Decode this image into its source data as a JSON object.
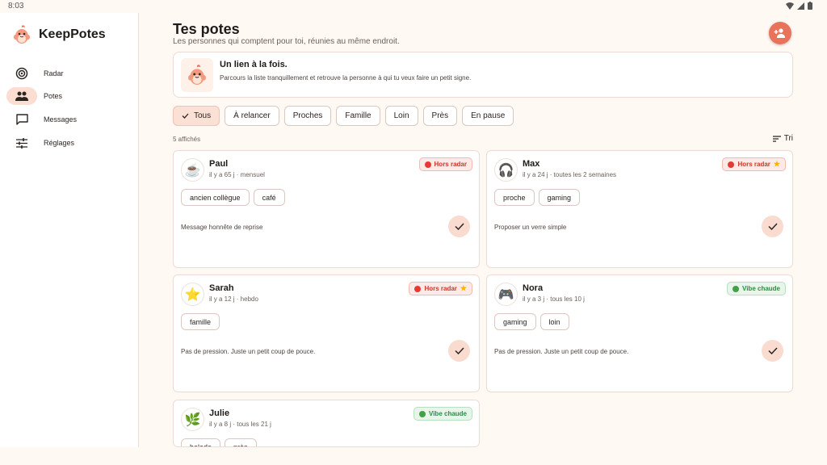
{
  "status": {
    "time": "8:03"
  },
  "app": {
    "name": "KeepPotes"
  },
  "nav": [
    {
      "label": "Radar",
      "icon": "radar-icon"
    },
    {
      "label": "Potes",
      "icon": "people-icon",
      "active": true
    },
    {
      "label": "Messages",
      "icon": "message-icon"
    },
    {
      "label": "Réglages",
      "icon": "settings-sliders-icon"
    }
  ],
  "header": {
    "title": "Tes potes",
    "subtitle": "Les personnes qui comptent pour toi, réunies au même endroit."
  },
  "hero": {
    "title": "Un lien à la fois.",
    "text": "Parcours la liste tranquillement et retrouve la personne à qui tu veux faire un petit signe."
  },
  "filters": [
    {
      "label": "Tous",
      "selected": true
    },
    {
      "label": "À relancer"
    },
    {
      "label": "Proches"
    },
    {
      "label": "Famille"
    },
    {
      "label": "Loin"
    },
    {
      "label": "Près"
    },
    {
      "label": "En pause"
    }
  ],
  "list": {
    "count_label": "5 affichés",
    "sort_label": "Tri"
  },
  "friends": [
    {
      "name": "Paul",
      "avatar": "☕",
      "meta": "il y a 65 j · mensuel",
      "badge": "Hors radar",
      "badge_type": "red",
      "starred": false,
      "tags": [
        "ancien collègue",
        "café"
      ],
      "note": "Message honnête de reprise"
    },
    {
      "name": "Max",
      "avatar": "🎧",
      "meta": "il y a 24 j · toutes les 2 semaines",
      "badge": "Hors radar",
      "badge_type": "red",
      "starred": true,
      "tags": [
        "proche",
        "gaming"
      ],
      "note": "Proposer un verre simple"
    },
    {
      "name": "Sarah",
      "avatar": "⭐",
      "meta": "il y a 12 j · hebdo",
      "badge": "Hors radar",
      "badge_type": "red",
      "starred": true,
      "tags": [
        "famille"
      ],
      "note": "Pas de pression. Juste un petit coup de pouce."
    },
    {
      "name": "Nora",
      "avatar": "🎮",
      "meta": "il y a 3 j · tous les 10 j",
      "badge": "Vibe chaude",
      "badge_type": "green",
      "starred": false,
      "tags": [
        "gaming",
        "loin"
      ],
      "note": "Pas de pression. Juste un petit coup de pouce."
    },
    {
      "name": "Julie",
      "avatar": "🌿",
      "meta": "il y a 8 j · tous les 21 j",
      "badge": "Vibe chaude",
      "badge_type": "green",
      "starred": false,
      "tags": [
        "balade",
        "près"
      ],
      "note": ""
    }
  ],
  "colors": {
    "accent": "#E8735A",
    "background": "#FFF8F3",
    "nav_active": "#FBDDD1",
    "hors_radar": "#c7392b",
    "vibe_chaude": "#2e8b45"
  }
}
